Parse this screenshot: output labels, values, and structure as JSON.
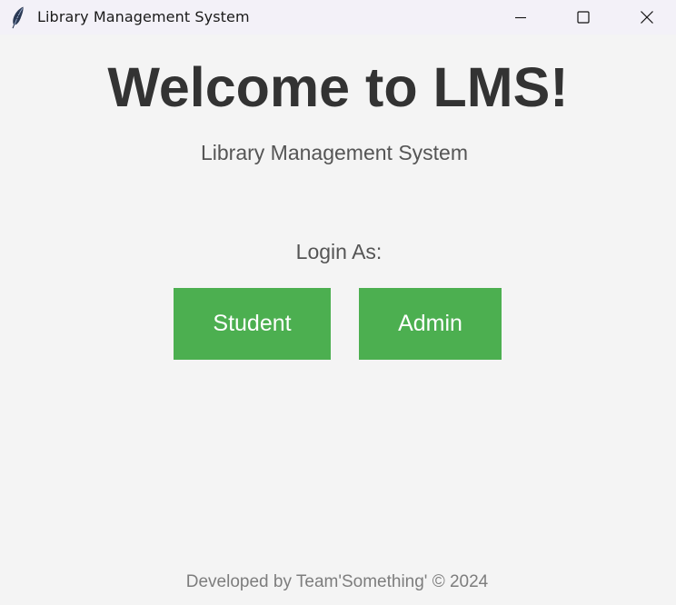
{
  "window": {
    "title": "Library Management System",
    "icon": "feather-icon",
    "controls": [
      "minimize",
      "maximize",
      "close"
    ]
  },
  "main": {
    "heading": "Welcome to LMS!",
    "subtitle": "Library Management System",
    "login_label": "Login As:",
    "buttons": {
      "student_label": "Student",
      "admin_label": "Admin"
    },
    "footer": "Developed by Team'Something' © 2024"
  },
  "colors": {
    "button_bg": "#4caf50",
    "button_text": "#ffffff",
    "background": "#f4f4f4",
    "heading": "#333333",
    "subtitle": "#555555",
    "footer": "#7d7d7d"
  }
}
